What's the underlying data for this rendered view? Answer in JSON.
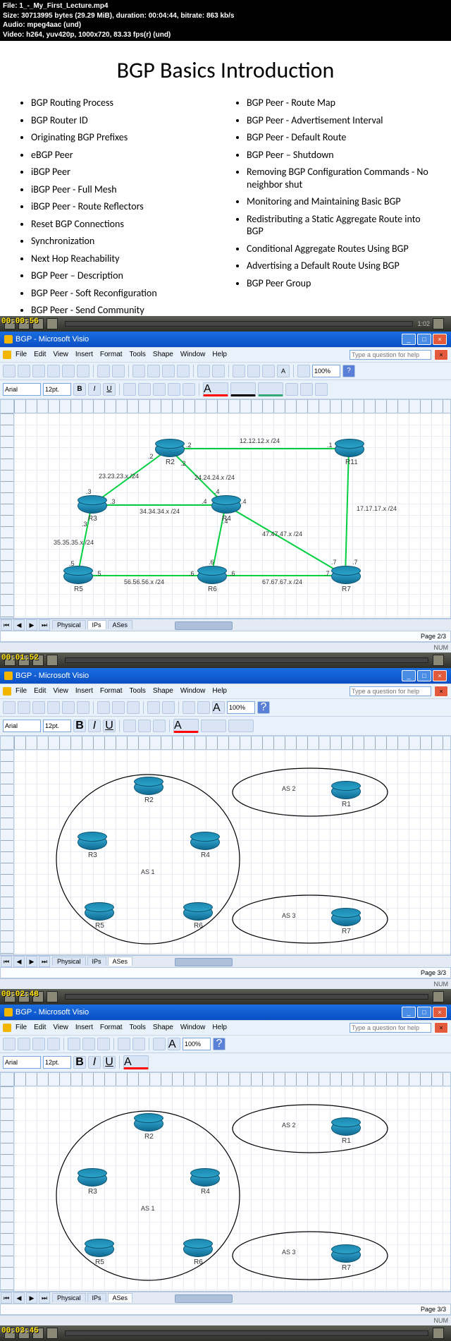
{
  "meta": {
    "file": "File: 1_-_My_First_Lecture.mp4",
    "size": "Size: 30713995 bytes (29.29 MiB), duration: 00:04:44, bitrate: 863 kb/s",
    "audio": "Audio: mpeg4aac (und)",
    "video": "Video: h264, yuv420p, 1000x720, 83.33 fps(r) (und)"
  },
  "slide": {
    "title": "BGP Basics Introduction",
    "col1": [
      "BGP Routing Process",
      "BGP Router ID",
      "Originating BGP Prefixes",
      "eBGP Peer",
      "iBGP Peer",
      "iBGP Peer - Full Mesh",
      "iBGP Peer - Route Reflectors",
      "Reset BGP Connections",
      "Synchronization",
      "Next Hop Reachability",
      "BGP Peer – Description",
      "BGP Peer - Soft Reconfiguration",
      "BGP Peer - Send Community"
    ],
    "col2": [
      "BGP Peer - Route Map",
      "BGP Peer - Advertisement Interval",
      "BGP Peer - Default Route",
      "BGP Peer – Shutdown",
      "Removing BGP Configuration Commands - No neighbor shut",
      "Monitoring and Maintaining Basic BGP",
      "Redistributing a Static Aggregate Route into BGP",
      "Conditional Aggregate Routes Using BGP",
      "Advertising a Default Route Using BGP",
      "BGP Peer Group"
    ]
  },
  "timestamps": {
    "t1": "00:00:56",
    "t2": "00:01:52",
    "t3": "00:02:48",
    "t4": "00:03:45"
  },
  "player_time": "1:02",
  "visio": {
    "title": "BGP - Microsoft Visio",
    "menus": [
      "File",
      "Edit",
      "View",
      "Insert",
      "Format",
      "Tools",
      "Shape",
      "Window",
      "Help"
    ],
    "help_placeholder": "Type a question for help",
    "font": "Arial",
    "fontsize": "12pt.",
    "zoom": "100%",
    "tabs": [
      "Physical",
      "IPs",
      "ASes"
    ],
    "page_a": "Page 2/3",
    "page_b": "Page 3/3",
    "status": "NUM"
  },
  "diagram1": {
    "routers": {
      "R1": "R1",
      "R2": "R2",
      "R3": "R3",
      "R4": "R4",
      "R5": "R5",
      "R6": "R6",
      "R7": "R7"
    },
    "labels": {
      "n1212": "12.12.12.x /24",
      "n2323": "23.23.23.x /24",
      "n2424": "24.24.24.x /24",
      "n3434": "34.34.34.x /24",
      "n1717": "17.17.17.x /24",
      "n3535": "35.35.35.x /24",
      "n4747": "47.47.47.x /24",
      "n5656": "56.56.56.x /24",
      "n6767": "67.67.67.x /24",
      "p1": ".1",
      "p2": ".2",
      "p3": ".3",
      "p4": ".4",
      "p5": ".5",
      "p6": ".6",
      "p7": ".7"
    }
  },
  "diagram2": {
    "routers": {
      "R1": "R1",
      "R2": "R2",
      "R3": "R3",
      "R4": "R4",
      "R5": "R5",
      "R6": "R6",
      "R7": "R7"
    },
    "as": {
      "as1": "AS 1",
      "as2": "AS 2",
      "as3": "AS 3"
    }
  }
}
